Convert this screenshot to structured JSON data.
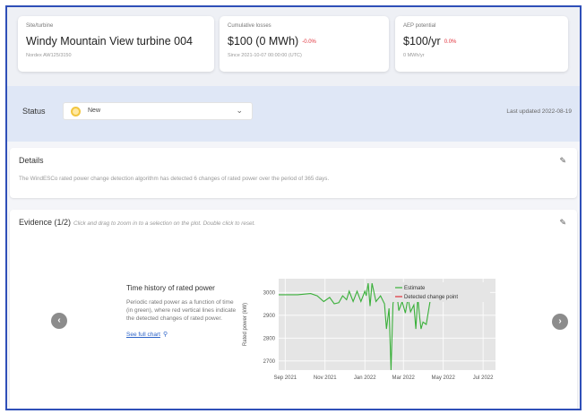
{
  "site": {
    "caption": "Site/turbine",
    "name": "Windy Mountain View turbine 004",
    "model": "Nordex AW125/3150"
  },
  "losses": {
    "caption": "Cumulative losses",
    "value": "$100 (0 MWh)",
    "change": "-0.0%",
    "since": "Since 2021-10-07 00:00:00 (UTC)"
  },
  "aep": {
    "caption": "AEP potential",
    "value": "$100/yr",
    "change": "0.0%",
    "sub": "0 MWh/yr"
  },
  "status": {
    "label": "Status",
    "selected": "New",
    "last_updated": "Last updated 2022-08-19"
  },
  "details": {
    "title": "Details",
    "text": "The WindESCo rated power change detection algorithm has detected 6 changes of rated power over the period of 365 days."
  },
  "evidence": {
    "title": "Evidence (1/2)",
    "hint": "Click and drag to zoom in to a selection on the plot. Double click to reset.",
    "plot_title": "Time history of rated power",
    "plot_desc": "Periodic rated power as a function of time (in green), where red vertical lines indicate the detected changes of rated power.",
    "full_chart_link": "See full chart",
    "prev_icon": "chevron-left-icon",
    "next_icon": "chevron-right-icon"
  },
  "colors": {
    "estimate": "#3ab03a",
    "change_point": "#e0303a",
    "accent": "#2c63c8",
    "status_new": "#f2c640"
  },
  "chart_data": {
    "type": "line",
    "ylabel": "Rated power (kW)",
    "ylim": [
      2660,
      3060
    ],
    "yticks": [
      2700,
      2800,
      2900,
      3000
    ],
    "xlim": [
      "2021-08-22",
      "2022-07-20"
    ],
    "xticks": [
      {
        "date": "2021-09-01",
        "label": "Sep 2021"
      },
      {
        "date": "2021-11-01",
        "label": "Nov 2021"
      },
      {
        "date": "2022-01-01",
        "label": "Jan 2022"
      },
      {
        "date": "2022-03-01",
        "label": "Mar 2022"
      },
      {
        "date": "2022-05-01",
        "label": "May 2022"
      },
      {
        "date": "2022-07-01",
        "label": "Jul 2022"
      }
    ],
    "legend": [
      "Estimate",
      "Detected change point"
    ],
    "legend_position": "top-right",
    "series": [
      {
        "name": "Estimate",
        "points": [
          [
            "2021-08-22",
            2990
          ],
          [
            "2021-09-20",
            2990
          ],
          [
            "2021-10-10",
            2995
          ],
          [
            "2021-10-20",
            2985
          ],
          [
            "2021-10-30",
            2960
          ],
          [
            "2021-11-08",
            2978
          ],
          [
            "2021-11-15",
            2950
          ],
          [
            "2021-11-22",
            2955
          ],
          [
            "2021-11-28",
            2985
          ],
          [
            "2021-12-04",
            2968
          ],
          [
            "2021-12-08",
            3005
          ],
          [
            "2021-12-14",
            2960
          ],
          [
            "2021-12-20",
            3005
          ],
          [
            "2021-12-26",
            2960
          ],
          [
            "2022-01-01",
            3005
          ],
          [
            "2022-01-03",
            2985
          ],
          [
            "2022-01-06",
            3040
          ],
          [
            "2022-01-09",
            2940
          ],
          [
            "2022-01-12",
            3040
          ],
          [
            "2022-01-18",
            2960
          ],
          [
            "2022-01-25",
            2985
          ],
          [
            "2022-01-31",
            2950
          ],
          [
            "2022-02-03",
            2840
          ],
          [
            "2022-02-07",
            2930
          ],
          [
            "2022-02-10",
            2660
          ],
          [
            "2022-02-13",
            2950
          ],
          [
            "2022-02-18",
            3020
          ],
          [
            "2022-02-22",
            2920
          ],
          [
            "2022-02-27",
            2960
          ],
          [
            "2022-03-04",
            2910
          ],
          [
            "2022-03-08",
            2975
          ],
          [
            "2022-03-12",
            2915
          ],
          [
            "2022-03-17",
            2945
          ],
          [
            "2022-03-20",
            2840
          ],
          [
            "2022-03-23",
            2980
          ],
          [
            "2022-03-26",
            2890
          ],
          [
            "2022-03-28",
            2840
          ],
          [
            "2022-03-31",
            2870
          ],
          [
            "2022-04-05",
            2860
          ],
          [
            "2022-04-12",
            2980
          ],
          [
            "2022-04-15",
            2985
          ]
        ]
      },
      {
        "name": "Detected change point",
        "points": []
      }
    ]
  }
}
